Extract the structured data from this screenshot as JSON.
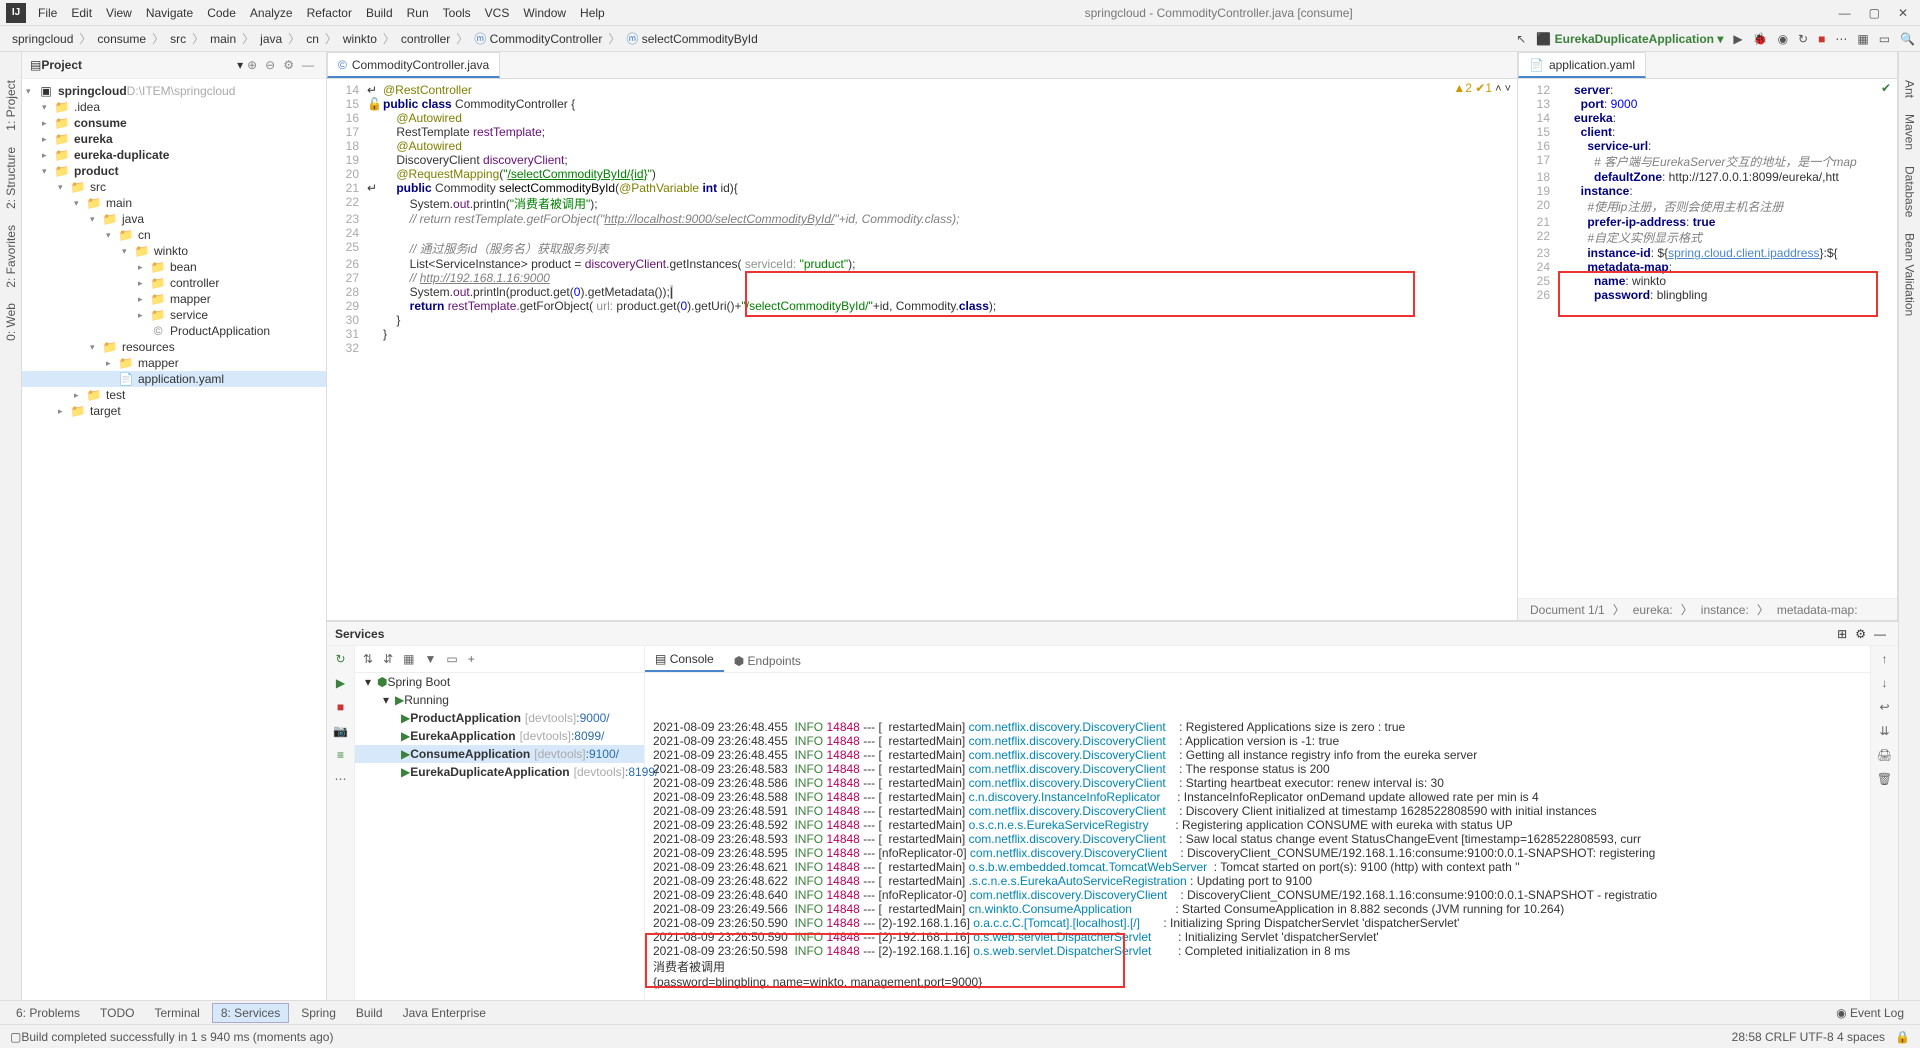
{
  "title": "springcloud - CommodityController.java [consume]",
  "menu": [
    "File",
    "Edit",
    "View",
    "Navigate",
    "Code",
    "Analyze",
    "Refactor",
    "Build",
    "Run",
    "Tools",
    "VCS",
    "Window",
    "Help"
  ],
  "breadcrumbs": [
    "springcloud",
    "consume",
    "src",
    "main",
    "java",
    "cn",
    "winkto",
    "controller",
    "CommodityController",
    "selectCommodityById"
  ],
  "runconfig": "EurekaDuplicateApplication",
  "project": {
    "title": "Project",
    "root": "springcloud",
    "rootPath": "D:\\ITEM\\springcloud",
    "nodes": [
      {
        "ind": 1,
        "arr": "▾",
        "ico": "📁",
        "label": ".idea"
      },
      {
        "ind": 1,
        "arr": "▸",
        "ico": "📁",
        "label": "consume",
        "bold": true
      },
      {
        "ind": 1,
        "arr": "▸",
        "ico": "📁",
        "label": "eureka",
        "bold": true
      },
      {
        "ind": 1,
        "arr": "▸",
        "ico": "📁",
        "label": "eureka-duplicate",
        "bold": true
      },
      {
        "ind": 1,
        "arr": "▾",
        "ico": "📁",
        "label": "product",
        "bold": true
      },
      {
        "ind": 2,
        "arr": "▾",
        "ico": "📁",
        "label": "src"
      },
      {
        "ind": 3,
        "arr": "▾",
        "ico": "📁",
        "label": "main"
      },
      {
        "ind": 4,
        "arr": "▾",
        "ico": "📁",
        "label": "java"
      },
      {
        "ind": 5,
        "arr": "▾",
        "ico": "📁",
        "label": "cn"
      },
      {
        "ind": 6,
        "arr": "▾",
        "ico": "📁",
        "label": "winkto"
      },
      {
        "ind": 7,
        "arr": "▸",
        "ico": "📁",
        "label": "bean"
      },
      {
        "ind": 7,
        "arr": "▸",
        "ico": "📁",
        "label": "controller"
      },
      {
        "ind": 7,
        "arr": "▸",
        "ico": "📁",
        "label": "mapper"
      },
      {
        "ind": 7,
        "arr": "▸",
        "ico": "📁",
        "label": "service"
      },
      {
        "ind": 7,
        "arr": " ",
        "ico": "©",
        "label": "ProductApplication"
      },
      {
        "ind": 4,
        "arr": "▾",
        "ico": "📁",
        "label": "resources"
      },
      {
        "ind": 5,
        "arr": "▸",
        "ico": "📁",
        "label": "mapper"
      },
      {
        "ind": 5,
        "arr": " ",
        "ico": "📄",
        "label": "application.yaml",
        "sel": true
      },
      {
        "ind": 3,
        "arr": "▸",
        "ico": "📁",
        "label": "test"
      },
      {
        "ind": 2,
        "arr": "▸",
        "ico": "📁",
        "label": "target",
        "orange": true
      }
    ]
  },
  "editorTab1": "CommodityController.java",
  "editorTab2": "application.yaml",
  "code1": [
    {
      "n": 14,
      "gm": "↵",
      "h": "<span class='ann'>@RestController</span>"
    },
    {
      "n": 15,
      "gm": "🔓",
      "h": "<span class='kw'>public class</span> CommodityController {"
    },
    {
      "n": 16,
      "h": "    <span class='ann'>@Autowired</span>"
    },
    {
      "n": 17,
      "h": "    RestTemplate <span class='fld'>restTemplate</span>;"
    },
    {
      "n": 18,
      "h": "    <span class='ann'>@Autowired</span>"
    },
    {
      "n": 19,
      "h": "    DiscoveryClient <span class='fld'>discoveryClient</span>;"
    },
    {
      "n": 20,
      "h": "    <span class='ann'>@RequestMapping</span>(<span class='str'>\"<u>/selectCommodityById/{id}</u>\"</span>)"
    },
    {
      "n": 21,
      "gm": "↵",
      "h": "    <span class='kw'>public</span> Commodity <span class='mtd'>selectCommodityById</span>(<span class='ann'>@PathVariable</span> <span class='kw'>int</span> id){"
    },
    {
      "n": 22,
      "h": "        System.<span class='fld'>out</span>.println(<span class='str'>\"消费者被调用\"</span>);"
    },
    {
      "n": 23,
      "h": "        <span class='cmt'>// return restTemplate.getForObject(\"<span class='link'>http://localhost:9000/selectCommodityById/</span>\"+id, Commodity.class);</span>"
    },
    {
      "n": 24,
      "h": ""
    },
    {
      "n": 25,
      "h": "        <span class='cmt'>// 通过服务id（服务名）获取服务列表</span>"
    },
    {
      "n": 26,
      "h": "        List&lt;ServiceInstance&gt; product = <span class='fld'>discoveryClient</span>.getInstances( <span style='color:#909090'>serviceId:</span> <span class='str'>\"pruduct\"</span>);"
    },
    {
      "n": 27,
      "h": "        <span class='cmt'>// <span class='link'>http://192.168.1.16:9000</span></span>"
    },
    {
      "n": 28,
      "h": "        System.<span class='fld'>out</span>.println(product.get(<span class='num'>0</span>).getMetadata());<span style='background:#ccc'>|</span>"
    },
    {
      "n": 29,
      "h": "        <span class='kw'>return</span> <span class='fld'>restTemplate</span>.getForObject( <span style='color:#909090'>url:</span> product.get(<span class='num'>0</span>).getUri()+<span class='str'>\"/selectCommodityById/\"</span>+id, Commodity.<span class='kw'>class</span>);"
    },
    {
      "n": 30,
      "h": "    }"
    },
    {
      "n": 31,
      "h": "}"
    },
    {
      "n": 32,
      "h": ""
    }
  ],
  "code2": [
    {
      "n": 12,
      "h": "<span class='kw'>server</span>:"
    },
    {
      "n": 13,
      "h": "  <span class='kw'>port</span>: <span class='num'>9000</span>"
    },
    {
      "n": 14,
      "h": "<span class='kw'>eureka</span>:"
    },
    {
      "n": 15,
      "h": "  <span class='kw'>client</span>:"
    },
    {
      "n": 16,
      "h": "    <span class='kw'>service-url</span>:"
    },
    {
      "n": 17,
      "h": "      <span class='cmt'># 客户端与EurekaServer交互的地址，是一个map</span>"
    },
    {
      "n": 18,
      "h": "      <span class='kw'>defaultZone</span>: http://127.0.0.1:8099/eureka/,htt"
    },
    {
      "n": 19,
      "h": "  <span class='kw'>instance</span>:"
    },
    {
      "n": 20,
      "h": "    <span class='cmt'>#使用ip注册，否则会使用主机名注册</span>"
    },
    {
      "n": 21,
      "h": "    <span class='kw'>prefer-ip-address</span>: <span class='kw'>true</span>"
    },
    {
      "n": 22,
      "h": "    <span class='cmt'>#自定义实例显示格式</span>"
    },
    {
      "n": 23,
      "h": "    <span class='kw'>instance-id</span>: ${<u style='color:#4a86cf'>spring.cloud.client.ipaddress</u>}:${"
    },
    {
      "n": 24,
      "h": "    <span class='kw'>metadata-map</span>:"
    },
    {
      "n": 25,
      "h": "      <span class='kw'>name</span>: winkto"
    },
    {
      "n": 26,
      "h": "      <span class='kw'>password</span>: blingbling"
    }
  ],
  "yamlCrumb": [
    "Document 1/1",
    "eureka:",
    "instance:",
    "metadata-map:"
  ],
  "inspections": "▲2 ✔1",
  "servicesTitle": "Services",
  "springBoot": "Spring Boot",
  "running": "Running",
  "apps": [
    {
      "name": "ProductApplication",
      "tag": "[devtools]",
      "port": ":9000/"
    },
    {
      "name": "EurekaApplication",
      "tag": "[devtools]",
      "port": ":8099/"
    },
    {
      "name": "ConsumeApplication",
      "tag": "[devtools]",
      "port": ":9100/",
      "sel": true
    },
    {
      "name": "EurekaDuplicateApplication",
      "tag": "[devtools]",
      "port": ":8199/"
    }
  ],
  "consoleTabs": [
    "Console",
    "Endpoints"
  ],
  "log": [
    {
      "t": "2021-08-09 23:26:48.455",
      "c": "com.netflix.discovery.DiscoveryClient",
      "th": "restartedMain",
      "m": "Registered Applications size is zero : true"
    },
    {
      "t": "2021-08-09 23:26:48.455",
      "c": "com.netflix.discovery.DiscoveryClient",
      "th": "restartedMain",
      "m": "Application version is -1: true"
    },
    {
      "t": "2021-08-09 23:26:48.455",
      "c": "com.netflix.discovery.DiscoveryClient",
      "th": "restartedMain",
      "m": "Getting all instance registry info from the eureka server"
    },
    {
      "t": "2021-08-09 23:26:48.583",
      "c": "com.netflix.discovery.DiscoveryClient",
      "th": "restartedMain",
      "m": "The response status is 200"
    },
    {
      "t": "2021-08-09 23:26:48.586",
      "c": "com.netflix.discovery.DiscoveryClient",
      "th": "restartedMain",
      "m": "Starting heartbeat executor: renew interval is: 30"
    },
    {
      "t": "2021-08-09 23:26:48.588",
      "c": "c.n.discovery.InstanceInfoReplicator",
      "th": "restartedMain",
      "m": "InstanceInfoReplicator onDemand update allowed rate per min is 4"
    },
    {
      "t": "2021-08-09 23:26:48.591",
      "c": "com.netflix.discovery.DiscoveryClient",
      "th": "restartedMain",
      "m": "Discovery Client initialized at timestamp 1628522808590 with initial instances"
    },
    {
      "t": "2021-08-09 23:26:48.592",
      "c": "o.s.c.n.e.s.EurekaServiceRegistry",
      "th": "restartedMain",
      "m": "Registering application CONSUME with eureka with status UP"
    },
    {
      "t": "2021-08-09 23:26:48.593",
      "c": "com.netflix.discovery.DiscoveryClient",
      "th": "restartedMain",
      "m": "Saw local status change event StatusChangeEvent [timestamp=1628522808593, curr"
    },
    {
      "t": "2021-08-09 23:26:48.595",
      "c": "com.netflix.discovery.DiscoveryClient",
      "th": "nfoReplicator-0",
      "m": "DiscoveryClient_CONSUME/192.168.1.16:consume:9100:0.0.1-SNAPSHOT: registering"
    },
    {
      "t": "2021-08-09 23:26:48.621",
      "c": "o.s.b.w.embedded.tomcat.TomcatWebServer",
      "th": "restartedMain",
      "m": "Tomcat started on port(s): 9100 (http) with context path ''"
    },
    {
      "t": "2021-08-09 23:26:48.622",
      "c": ".s.c.n.e.s.EurekaAutoServiceRegistration",
      "th": "restartedMain",
      "m": "Updating port to 9100"
    },
    {
      "t": "2021-08-09 23:26:48.640",
      "c": "com.netflix.discovery.DiscoveryClient",
      "th": "nfoReplicator-0",
      "m": "DiscoveryClient_CONSUME/192.168.1.16:consume:9100:0.0.1-SNAPSHOT - registratio"
    },
    {
      "t": "2021-08-09 23:26:49.566",
      "c": "cn.winkto.ConsumeApplication",
      "th": "restartedMain",
      "m": "Started ConsumeApplication in 8.882 seconds (JVM running for 10.264)"
    },
    {
      "t": "2021-08-09 23:26:50.590",
      "c": "o.a.c.c.C.[Tomcat].[localhost].[/]",
      "th": "2)-192.168.1.16",
      "m": "Initializing Spring DispatcherServlet 'dispatcherServlet'"
    },
    {
      "t": "2021-08-09 23:26:50.590",
      "c": "o.s.web.servlet.DispatcherServlet",
      "th": "2)-192.168.1.16",
      "m": "Initializing Servlet 'dispatcherServlet'"
    },
    {
      "t": "2021-08-09 23:26:50.598",
      "c": "o.s.web.servlet.DispatcherServlet",
      "th": "2)-192.168.1.16",
      "m": "Completed initialization in 8 ms"
    }
  ],
  "logPid": "14848",
  "logExtra": [
    "消费者被调用",
    "{password=blingbling, name=winkto, management.port=9000}"
  ],
  "bottomTabs": [
    "Problems",
    "TODO",
    "Terminal",
    "Services",
    "Spring",
    "Build",
    "Java Enterprise"
  ],
  "bottomActive": 3,
  "eventLog": "Event Log",
  "statusLeft": "Build completed successfully in 1 s 940 ms (moments ago)",
  "statusRight": "28:58   CRLF   UTF-8   4 spaces",
  "leftTabs": [
    "1: Project",
    "2: Structure",
    "2: Favorites",
    "0: Web"
  ],
  "rightTabs": [
    "Ant",
    "Maven",
    "Database",
    "Bean Validation"
  ]
}
